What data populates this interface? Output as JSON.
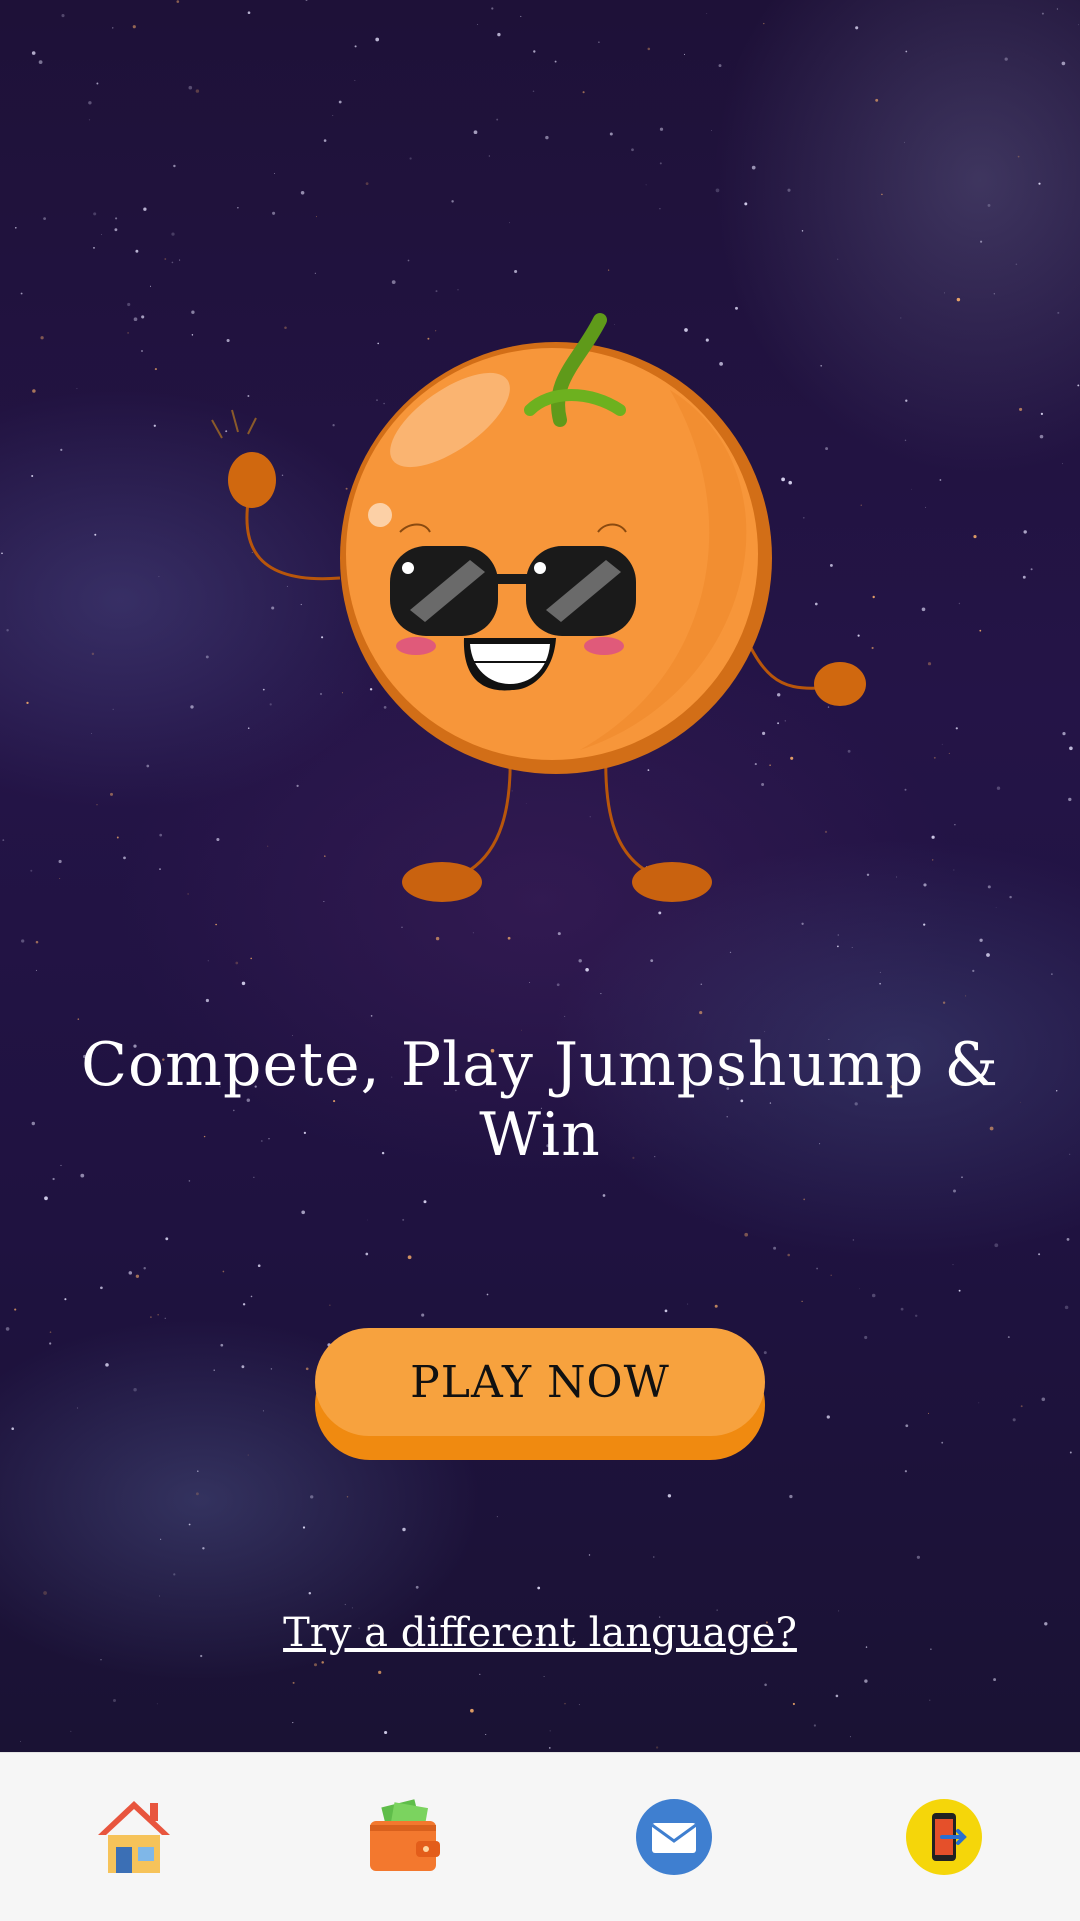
{
  "headline": "Compete, Play Jumpshump & Win",
  "play_button": {
    "label": "PLAY NOW"
  },
  "language_link": {
    "label": "Try a different language?"
  },
  "mascot": {
    "icon": "orange-mascot-with-sunglasses"
  },
  "bottom_nav": {
    "items": [
      {
        "name": "home",
        "icon": "house-icon"
      },
      {
        "name": "wallet",
        "icon": "wallet-icon"
      },
      {
        "name": "messages",
        "icon": "envelope-icon"
      },
      {
        "name": "logout",
        "icon": "phone-exit-icon"
      }
    ]
  },
  "colors": {
    "background": "#1e1138",
    "button": "#f7a23e",
    "button_shadow": "#f08a10",
    "nav_background": "#f6f6f6"
  }
}
